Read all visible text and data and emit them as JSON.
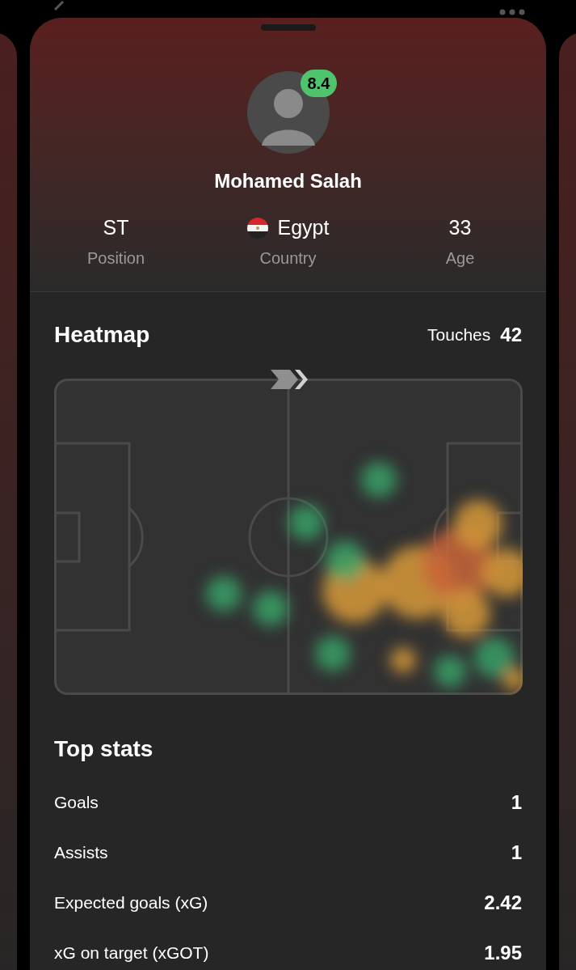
{
  "player": {
    "name": "Mohamed Salah",
    "rating": "8.4"
  },
  "facts": [
    {
      "kind": "text",
      "value": "ST",
      "label": "Position"
    },
    {
      "kind": "country",
      "value": "Egypt",
      "label": "Country"
    },
    {
      "kind": "text",
      "value": "33",
      "label": "Age"
    }
  ],
  "heatmap": {
    "title": "Heatmap",
    "touches_label": "Touches",
    "touches": "42"
  },
  "top_stats": {
    "title": "Top stats",
    "rows": [
      {
        "label": "Goals",
        "value": "1"
      },
      {
        "label": "Assists",
        "value": "1"
      },
      {
        "label": "Expected goals (xG)",
        "value": "2.42"
      },
      {
        "label": "xG on target (xGOT)",
        "value": "1.95"
      }
    ]
  }
}
